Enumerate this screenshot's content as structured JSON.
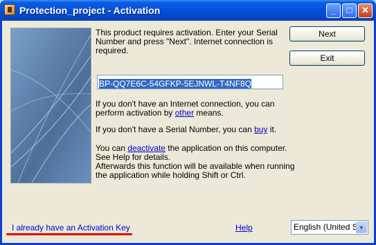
{
  "window": {
    "title": "Protection_project - Activation"
  },
  "titlebar_buttons": {
    "minimize": "_",
    "maximize": "□",
    "close": "✕"
  },
  "message": {
    "line1": "This product requires activation. Enter your Serial",
    "line2": "Number and press \"Next\". Internet connection is",
    "line3": "required."
  },
  "serial_field": {
    "value": "BP-QQ7E6C-54GFKP-5EJNWL-T4NF8Q"
  },
  "no_internet": {
    "line1": "If you don't have an Internet connection, you can",
    "line2_prefix": "perform activation by ",
    "link": "other",
    "line2_suffix": " means."
  },
  "no_serial": {
    "prefix": "If you don't have a Serial Number, you can ",
    "link": "buy",
    "suffix": " it."
  },
  "deactivate": {
    "prefix": "You can ",
    "link": "deactivate",
    "suffix": " the application on this computer.",
    "line2": "See Help for details.",
    "line3": "Afterwards this function will be available when running",
    "line4": "the application while holding Shift or Ctrl."
  },
  "buttons": {
    "next": "Next",
    "exit": "Exit"
  },
  "footer": {
    "activation_key_link": "I already have an Activation Key",
    "help_link": "Help",
    "language": "English (United Sta"
  }
}
